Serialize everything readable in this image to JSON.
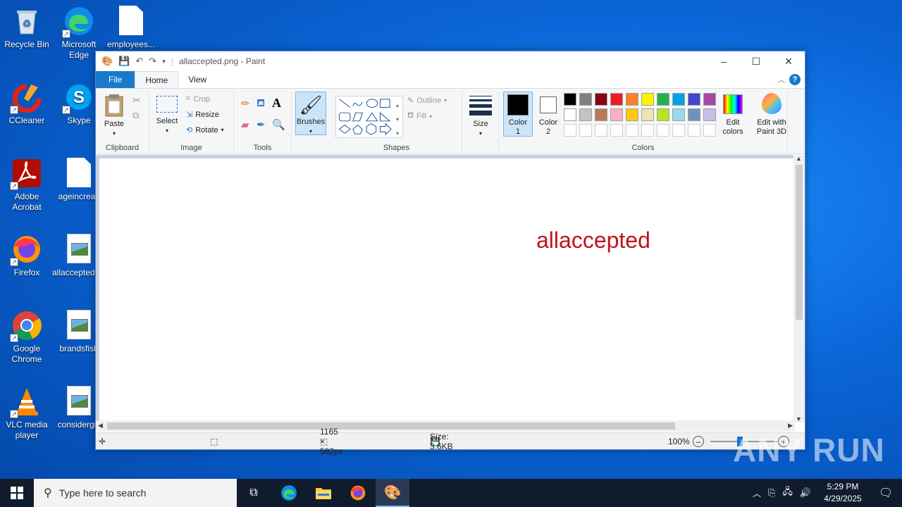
{
  "desktop": {
    "icons": [
      {
        "label": "Recycle Bin"
      },
      {
        "label": "Microsoft Edge"
      },
      {
        "label": "employees..."
      },
      {
        "label": "CCleaner"
      },
      {
        "label": "Skype"
      },
      {
        "label": "Adobe Acrobat"
      },
      {
        "label": "ageincreas"
      },
      {
        "label": "Firefox"
      },
      {
        "label": "allaccepted.png"
      },
      {
        "label": "Google Chrome"
      },
      {
        "label": "brandsfish"
      },
      {
        "label": "VLC media player"
      },
      {
        "label": "considergiv"
      }
    ]
  },
  "window": {
    "title": "allaccepted.png - Paint",
    "controls": {
      "minimize": "–",
      "maximize": "☐",
      "close": "✕"
    }
  },
  "tabs": {
    "file": "File",
    "home": "Home",
    "view": "View"
  },
  "ribbon": {
    "clipboard": {
      "paste": "Paste",
      "group": "Clipboard"
    },
    "image": {
      "select": "Select",
      "crop": "Crop",
      "resize": "Resize",
      "rotate": "Rotate",
      "group": "Image"
    },
    "tools": {
      "group": "Tools"
    },
    "brushes": {
      "label": "Brushes"
    },
    "shapes": {
      "outline": "Outline",
      "fill": "Fill",
      "group": "Shapes"
    },
    "size": {
      "label": "Size"
    },
    "colors": {
      "color1": "Color 1",
      "color2": "Color 2",
      "edit_colors": "Edit colors",
      "group": "Colors",
      "color1_value": "#000000",
      "color2_value": "#ffffff",
      "palette_row1": [
        "#000000",
        "#7f7f7f",
        "#880015",
        "#ed1c24",
        "#ff7f27",
        "#fff200",
        "#22b14c",
        "#00a2e8",
        "#3f48cc",
        "#a349a4"
      ],
      "palette_row2": [
        "#ffffff",
        "#c3c3c3",
        "#b97a57",
        "#ffaec9",
        "#ffc90e",
        "#efe4b0",
        "#b5e61d",
        "#99d9ea",
        "#7092be",
        "#c8bfe7"
      ],
      "palette_row3": [
        "#ffffff",
        "#ffffff",
        "#ffffff",
        "#ffffff",
        "#ffffff",
        "#ffffff",
        "#ffffff",
        "#ffffff",
        "#ffffff",
        "#ffffff"
      ]
    },
    "paint3d": {
      "label": "Edit with Paint 3D"
    }
  },
  "canvas": {
    "text": "allaccepted",
    "text_color": "#c0131c"
  },
  "status": {
    "dimensions": "1165 × 582px",
    "size": "Size: 3.6KB",
    "zoom": "100%"
  },
  "taskbar": {
    "search_placeholder": "Type here to search",
    "time": "5:29 PM",
    "date": "4/29/2025"
  },
  "watermark": "ANY RUN"
}
